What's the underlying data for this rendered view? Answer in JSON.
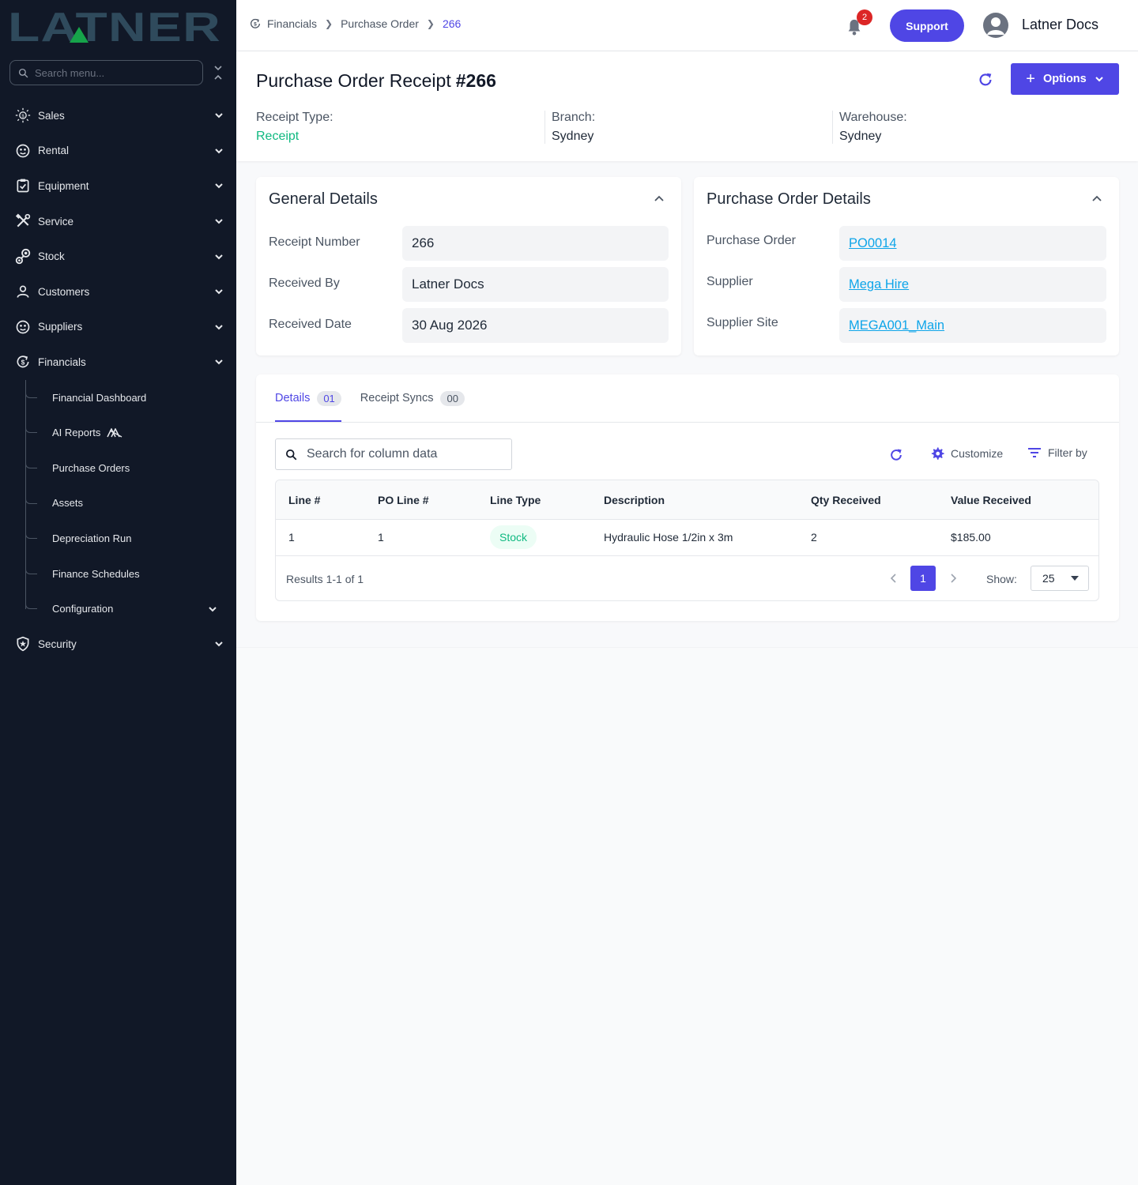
{
  "app": {
    "logo_text": "LATNER"
  },
  "sidebar": {
    "search_placeholder": "Search menu...",
    "items": [
      {
        "label": "Sales",
        "icon": "sales-icon"
      },
      {
        "label": "Rental",
        "icon": "rental-icon"
      },
      {
        "label": "Equipment",
        "icon": "equipment-icon"
      },
      {
        "label": "Service",
        "icon": "service-icon"
      },
      {
        "label": "Stock",
        "icon": "stock-icon"
      },
      {
        "label": "Customers",
        "icon": "customers-icon"
      },
      {
        "label": "Suppliers",
        "icon": "suppliers-icon"
      },
      {
        "label": "Financials",
        "icon": "financials-icon"
      },
      {
        "label": "Security",
        "icon": "security-icon"
      }
    ],
    "financials_sub": [
      {
        "label": "Financial Dashboard"
      },
      {
        "label": "AI Reports"
      },
      {
        "label": "Purchase Orders"
      },
      {
        "label": "Assets"
      },
      {
        "label": "Depreciation Run"
      },
      {
        "label": "Finance Schedules"
      },
      {
        "label": "Configuration"
      }
    ]
  },
  "header": {
    "breadcrumbs": [
      "Financials",
      "Purchase Order",
      "266"
    ],
    "notification_count": "2",
    "support_label": "Support",
    "user_name": "Latner Docs"
  },
  "page": {
    "title": "Purchase Order Receipt",
    "number": "#266",
    "options_label": "Options",
    "meta": [
      {
        "label": "Receipt Type:",
        "value": "Receipt",
        "value_color": "#10b981"
      },
      {
        "label": "Branch:",
        "value": "Sydney"
      },
      {
        "label": "Warehouse:",
        "value": "Sydney"
      }
    ]
  },
  "general_details": {
    "title": "General Details",
    "fields": [
      {
        "label": "Receipt Number",
        "value": "266"
      },
      {
        "label": "Received By",
        "value": "Latner Docs"
      },
      {
        "label": "Received Date",
        "value": "30 Aug 2026"
      }
    ]
  },
  "po_details": {
    "title": "Purchase Order Details",
    "fields": [
      {
        "label": "Purchase Order",
        "value": "PO0014"
      },
      {
        "label": "Supplier",
        "value": "Mega Hire"
      },
      {
        "label": "Supplier Site",
        "value": "MEGA001_Main"
      }
    ]
  },
  "tabs": [
    {
      "label": "Details",
      "count": "01",
      "active": true
    },
    {
      "label": "Receipt Syncs",
      "count": "00",
      "active": false
    }
  ],
  "grid": {
    "search_placeholder": "Search for column data",
    "customize_label": "Customize",
    "filter_label": "Filter by",
    "columns": [
      "Line #",
      "PO Line #",
      "Line Type",
      "Description",
      "Qty Received",
      "Value Received"
    ],
    "rows": [
      {
        "line": "1",
        "po_line": "1",
        "line_type": "Stock",
        "description": "Hydraulic Hose 1/2in x 3m",
        "qty": "2",
        "value": "$185.00"
      }
    ],
    "results_text": "Results 1-1 of 1",
    "current_page": "1",
    "show_label": "Show:",
    "page_size": "25"
  },
  "colors": {
    "accent": "#4f46e5",
    "sidebar_bg": "#111827",
    "success": "#10b981",
    "link": "#0ea5e9",
    "badge": "#dc2626"
  }
}
